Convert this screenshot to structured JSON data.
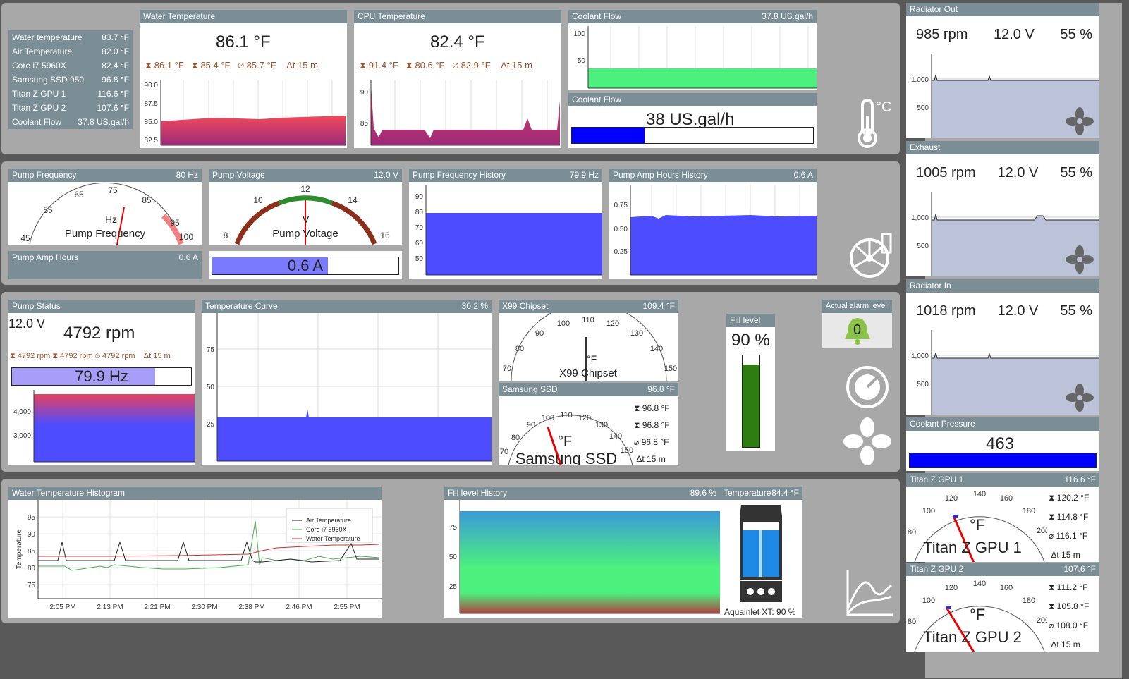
{
  "sensor_table": [
    {
      "label": "Water temperature",
      "value": "83.7 °F"
    },
    {
      "label": "Air Temperature",
      "value": "82.0 °F"
    },
    {
      "label": "Core i7 5960X",
      "value": "82.4 °F"
    },
    {
      "label": "Samsung SSD 950",
      "value": "96.8 °F"
    },
    {
      "label": "Titan Z GPU 1",
      "value": "116.6 °F"
    },
    {
      "label": "Titan Z GPU 2",
      "value": "107.6 °F"
    },
    {
      "label": "Coolant Flow",
      "value": "37.8 US.gal/h"
    }
  ],
  "water_temp": {
    "title": "Water Temperature",
    "value": "86.1 °F",
    "max": "86.1 °F",
    "min": "85.4 °F",
    "avg": "85.7 °F",
    "span": "15 m",
    "ticks": [
      "90.0",
      "87.5",
      "85.0",
      "82.5"
    ]
  },
  "cpu_temp": {
    "title": "CPU Temperature",
    "value": "82.4 °F",
    "max": "91.4 °F",
    "min": "80.6 °F",
    "avg": "82.9 °F",
    "span": "15 m",
    "ticks": [
      "90",
      "85"
    ]
  },
  "coolant_flow_chart": {
    "title": "Coolant Flow",
    "value": "37.8 US.gal/h",
    "ticks": [
      "100",
      "50"
    ]
  },
  "coolant_flow_bar": {
    "title": "Coolant Flow",
    "value": "38 US.gal/h",
    "fill": 0.3
  },
  "pump_freq_gauge": {
    "title": "Pump Frequency",
    "value": "80 Hz",
    "unit": "Hz",
    "label": "Pump Frequency",
    "ticks": [
      "45",
      "55",
      "65",
      "75",
      "85",
      "95",
      "100"
    ]
  },
  "pump_voltage_gauge": {
    "title": "Pump Voltage",
    "value": "12.0 V",
    "unit": "V",
    "label": "Pump Voltage",
    "ticks": [
      "8",
      "10",
      "12",
      "14",
      "16"
    ]
  },
  "pump_amp_hours": {
    "title": "Pump Amp Hours",
    "value": "0.6 A",
    "bar_value": "0.6 A",
    "fill": 0.62
  },
  "pump_freq_history": {
    "title": "Pump Frequency History",
    "value": "79.9 Hz",
    "ticks": [
      "90",
      "80",
      "70",
      "60",
      "50"
    ]
  },
  "pump_amp_history": {
    "title": "Pump Amp Hours History",
    "value": "0.6 A",
    "ticks": [
      "0.75",
      "0.50",
      "0.25"
    ]
  },
  "pump_status": {
    "title": "Pump Status",
    "voltage": "12.0 V",
    "rpm": "4792 rpm",
    "max": "4792 rpm",
    "min": "4792 rpm",
    "avg": "4792 rpm",
    "span": "15 m",
    "bar_value": "79.9 Hz",
    "fill": 0.8,
    "ticks": [
      "4,000",
      "3,000"
    ]
  },
  "temp_curve": {
    "title": "Temperature Curve",
    "value": "30.2 %",
    "ticks": [
      "75",
      "50",
      "25"
    ]
  },
  "x99": {
    "title": "X99 Chipset",
    "value": "109.4 °F",
    "unit": "°F",
    "label": "X99 Chipset",
    "ticks": [
      "70",
      "80",
      "90",
      "100",
      "110",
      "120",
      "130",
      "140",
      "150"
    ]
  },
  "ssd": {
    "title": "Samsung SSD",
    "value": "96.8 °F",
    "unit": "°F",
    "label": "Samsung SSD",
    "max": "96.8 °F",
    "min": "96.8 °F",
    "avg": "96.8 °F",
    "span": "15 m",
    "ticks": [
      "70",
      "80",
      "90",
      "100",
      "110",
      "120",
      "130",
      "140",
      "150"
    ]
  },
  "fill_level": {
    "title": "Fill level",
    "value": "90 %",
    "fill": 0.9
  },
  "alarm": {
    "title": "Actual alarm level",
    "value": "0"
  },
  "histogram": {
    "title": "Water Temperature Histogram",
    "ylabel": "Temperature",
    "yticks": [
      "95",
      "90",
      "85",
      "80",
      "75"
    ],
    "xticks": [
      "2:05 PM",
      "2:13 PM",
      "2:21 PM",
      "2:30 PM",
      "2:38 PM",
      "2:46 PM",
      "2:55 PM"
    ],
    "legend": [
      {
        "name": "Air Temperature",
        "color": "#222222"
      },
      {
        "name": "Core i7 5960X",
        "color": "#4caf50"
      },
      {
        "name": "Water Temperature",
        "color": "#d32f2f"
      }
    ]
  },
  "fill_history": {
    "title": "Fill level History",
    "value": "89.6 %",
    "ticks": [
      "75",
      "50",
      "25"
    ]
  },
  "aquainlet": {
    "title": "Temperature",
    "value": "84.4 °F",
    "caption": "Aquainlet XT: 90 %"
  },
  "fans": [
    {
      "title": "Radiator Out",
      "rpm": "985 rpm",
      "volt": "12.0 V",
      "pct": "55 %",
      "ticks": [
        "1,000",
        "500"
      ]
    },
    {
      "title": "Exhaust",
      "rpm": "1005 rpm",
      "volt": "12.0 V",
      "pct": "55 %",
      "ticks": [
        "1,000",
        "500"
      ]
    },
    {
      "title": "Radiator In",
      "rpm": "1018 rpm",
      "volt": "12.0 V",
      "pct": "55 %",
      "ticks": [
        "1,000",
        "500"
      ]
    }
  ],
  "coolant_pressure": {
    "title": "Coolant Pressure",
    "value": "463",
    "fill": 1.0
  },
  "gpu1": {
    "title": "Titan Z GPU 1",
    "value": "116.6 °F",
    "unit": "°F",
    "label": "Titan Z GPU 1",
    "max": "120.2 °F",
    "min": "114.8 °F",
    "avg": "116.1 °F",
    "span": "15 m",
    "ticks": [
      "80",
      "100",
      "120",
      "140",
      "160",
      "180",
      "200"
    ]
  },
  "gpu2": {
    "title": "Titan Z GPU 2",
    "value": "107.6 °F",
    "unit": "°F",
    "label": "Titan Z GPU 2",
    "max": "111.2 °F",
    "min": "105.8 °F",
    "avg": "108.0 °F",
    "span": "15 m",
    "ticks": [
      "80",
      "100",
      "120",
      "140",
      "160",
      "180",
      "200"
    ]
  },
  "unit_toggle": "°C",
  "colors": {
    "panel_header": "#7b8d95",
    "band": "#a8a8a8",
    "background": "#595959",
    "series_blue": "#4d4dff",
    "series_red": "#e53935",
    "bar_blue": "#0000ff",
    "fill_green": "#2e7d12"
  }
}
